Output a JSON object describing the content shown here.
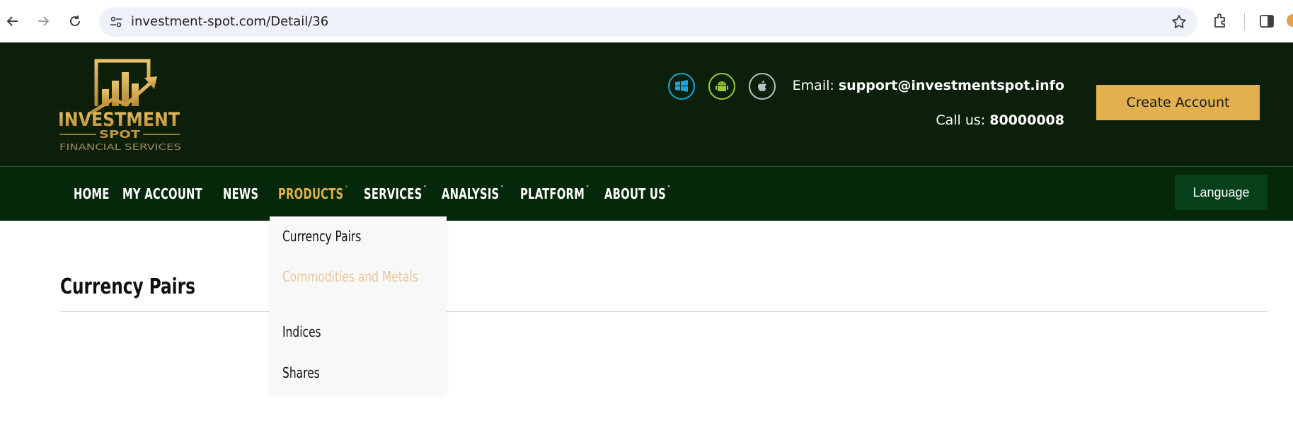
{
  "browser": {
    "url": "investment-spot.com/Detail/36",
    "icons": [
      "back-arrow-icon",
      "forward-arrow-icon",
      "reload-icon",
      "site-info-icon",
      "bookmark-star-icon",
      "extensions-icon",
      "side-panel-icon"
    ]
  },
  "header": {
    "logo": {
      "line1": "INVESTMENT",
      "line2": "SPOT",
      "line3": "FINANCIAL SERVICES"
    },
    "platforms": [
      "windows-icon",
      "android-icon",
      "apple-icon"
    ],
    "email_label": "Email:",
    "email_value": "support@investmentspot.info",
    "phone_label": "Call us:",
    "phone_value": "80000008",
    "create_account": "Create Account"
  },
  "nav": {
    "items": [
      {
        "label": "HOME",
        "dropdown": false
      },
      {
        "label": "MY ACCOUNT",
        "dropdown": false
      },
      {
        "label": "NEWS",
        "dropdown": false
      },
      {
        "label": "PRODUCTS",
        "dropdown": true,
        "active": true
      },
      {
        "label": "SERVICES",
        "dropdown": true
      },
      {
        "label": "ANALYSIS",
        "dropdown": true
      },
      {
        "label": "PLATFORM",
        "dropdown": true
      },
      {
        "label": "ABOUT US",
        "dropdown": true
      }
    ],
    "caret": "ˇ",
    "language": "Language"
  },
  "dropdown": {
    "items": [
      "Currency Pairs",
      "Commodities and Metals",
      "Indices",
      "Shares"
    ],
    "hovered": "Commodities and Metals"
  },
  "content": {
    "title": "Currency Pairs"
  },
  "colors": {
    "header_bg": "#0c1f0b",
    "nav_bg": "#05270a",
    "accent_gold": "#e2b04f",
    "language_bg": "#05401a",
    "hover_text": "#e7c79b"
  }
}
